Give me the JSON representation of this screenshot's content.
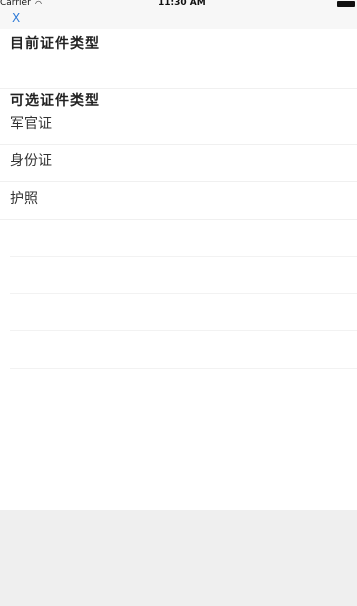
{
  "status_bar": {
    "carrier": "Carrier",
    "wifi_icon": "wifi-icon",
    "time": "11:30 AM",
    "battery_icon": "battery-icon"
  },
  "nav": {
    "close_label": "X"
  },
  "current_section": {
    "title": "目前证件类型"
  },
  "available_section": {
    "title": "可选证件类型",
    "items": [
      {
        "label": "军官证"
      },
      {
        "label": "身份证"
      },
      {
        "label": "护照"
      }
    ]
  },
  "colors": {
    "accent": "#2f7bd8",
    "bar_bg": "#f7f7f7",
    "bottom_bg": "#efefef"
  }
}
